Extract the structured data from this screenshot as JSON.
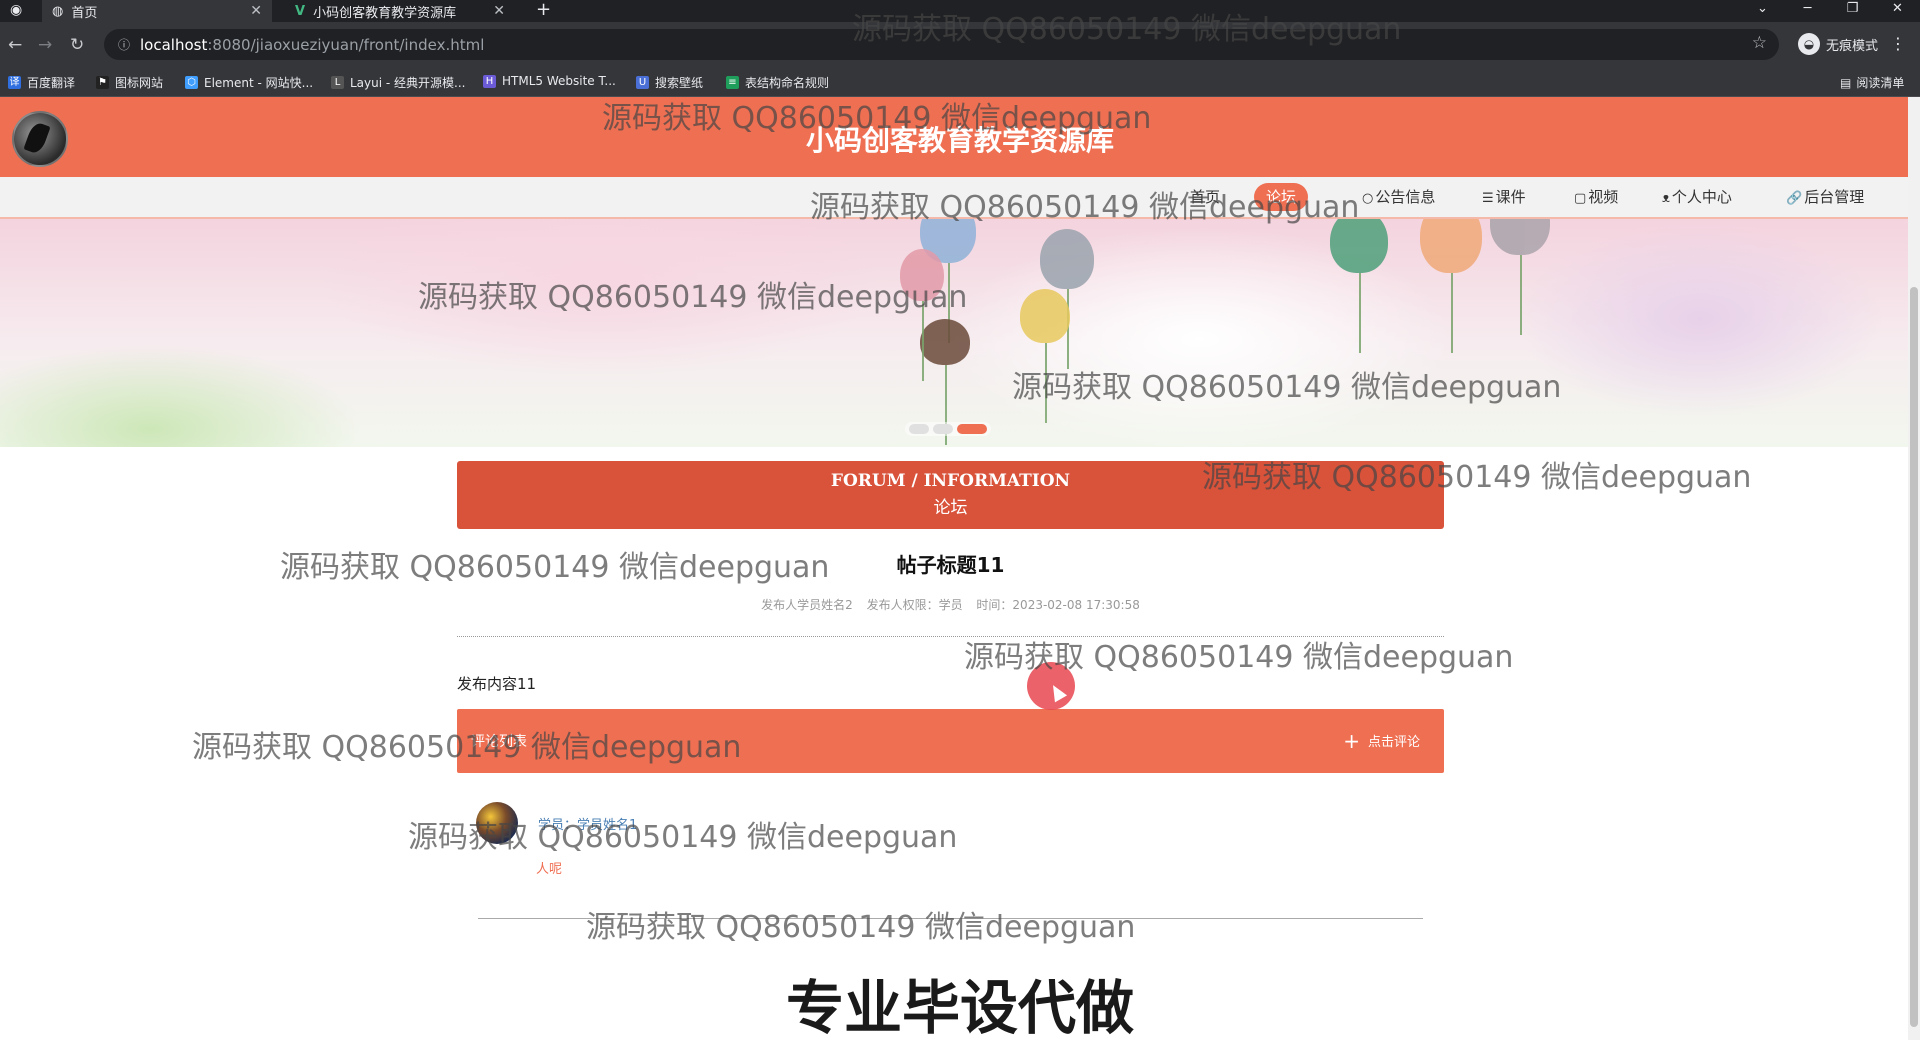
{
  "browser": {
    "tabs": [
      {
        "title": "首页",
        "active": true
      },
      {
        "title": "小码创客教育教学资源库",
        "active": false
      }
    ],
    "new_tab_label": "+",
    "url_host": "localhost",
    "url_path": ":8080/jiaoxueziyuan/front/index.html",
    "incognito_label": "无痕模式",
    "window_controls": [
      "⌄",
      "─",
      "❐",
      "✕"
    ],
    "bookmarks": [
      {
        "label": "百度翻译",
        "color": "#2f6fe0",
        "glyph": "译"
      },
      {
        "label": "图标网站",
        "color": "#222222",
        "glyph": "⚑"
      },
      {
        "label": "Element - 网站快...",
        "color": "#409eff",
        "glyph": "⬡"
      },
      {
        "label": "Layui - 经典开源模...",
        "color": "#555555",
        "glyph": "L"
      },
      {
        "label": "HTML5 Website T...",
        "color": "#6b5bd6",
        "glyph": "H"
      },
      {
        "label": "搜索壁纸",
        "color": "#4a6fd6",
        "glyph": "U"
      },
      {
        "label": "表结构命名规则",
        "color": "#1e9e5a",
        "glyph": "≡"
      }
    ],
    "reading_list_label": "阅读清单"
  },
  "site": {
    "title": "小码创客教育教学资源库",
    "nav": [
      {
        "label": "首页",
        "icon": "",
        "active": false
      },
      {
        "label": "论坛",
        "icon": "",
        "active": true
      },
      {
        "label": "公告信息",
        "icon": "○",
        "active": false
      },
      {
        "label": "课件",
        "icon": "☰",
        "active": false
      },
      {
        "label": "视频",
        "icon": "▢",
        "active": false
      },
      {
        "label": "个人中心",
        "icon": "ᴥ",
        "active": false
      },
      {
        "label": "后台管理",
        "icon": "🔗",
        "active": false
      }
    ],
    "carousel": {
      "count": 3,
      "active_index": 2
    }
  },
  "section": {
    "title_en": "FORUM / INFORMATION",
    "title_cn": "论坛"
  },
  "post": {
    "title": "帖子标题11",
    "author": "发布人学员姓名2",
    "role": "发布人权限：学员",
    "time": "时间：2023-02-08 17:30:58",
    "content": "发布内容11"
  },
  "comments": {
    "section_label": "评论列表",
    "add_button": "点击评论",
    "items": [
      {
        "user": "学员：学员姓名1",
        "text": "人呢"
      }
    ]
  },
  "overlay_text": "专业毕设代做",
  "watermark": "源码获取 QQ86050149 微信deepguan"
}
